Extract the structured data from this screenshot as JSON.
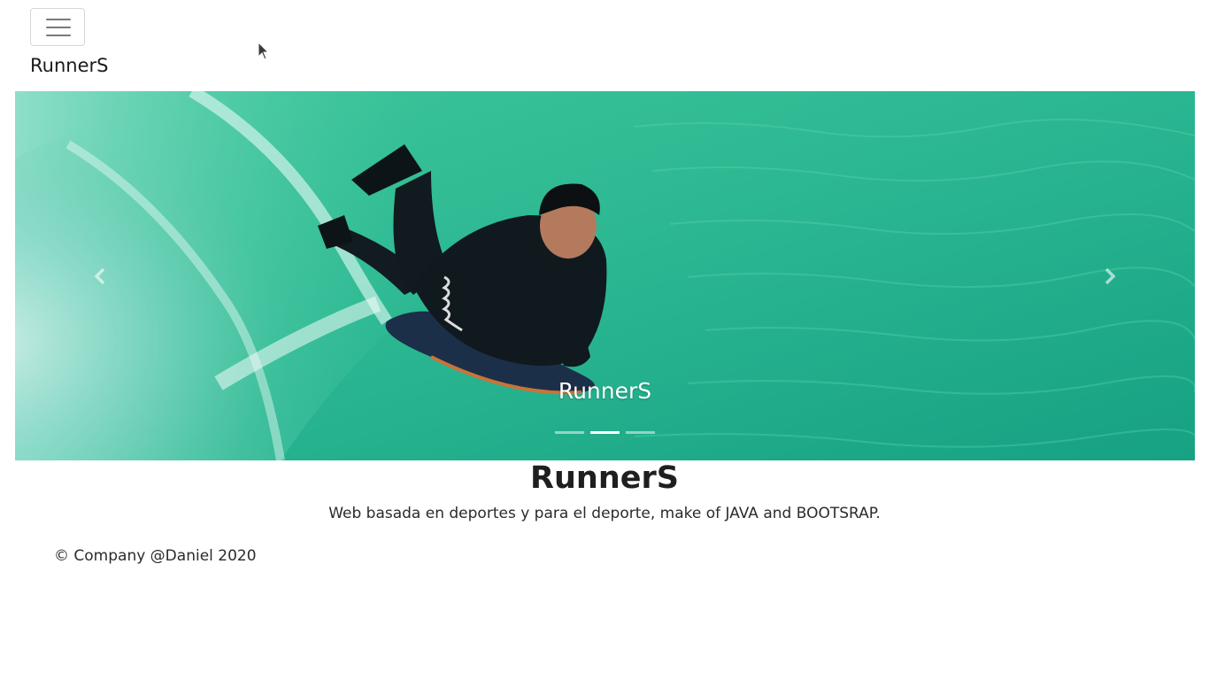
{
  "navbar": {
    "brand": "RunnerS",
    "toggler_icon": "hamburger-menu-icon"
  },
  "carousel": {
    "caption": "RunnerS",
    "slide_count": 3,
    "active_slide": 2,
    "prev_icon": "chevron-left-icon",
    "next_icon": "chevron-right-icon",
    "image_subject": "bodyboarder riding a green-turquoise wave"
  },
  "hero": {
    "title": "RunnerS",
    "text": "Web basada en deportes y para el deporte, make of JAVA and BOOTSRAP."
  },
  "footer": {
    "text": "© Company @Daniel 2020"
  },
  "colors": {
    "water_light": "#5fd6ad",
    "water_dark": "#14a584",
    "foam": "#d8f3ee",
    "text": "#212529"
  }
}
